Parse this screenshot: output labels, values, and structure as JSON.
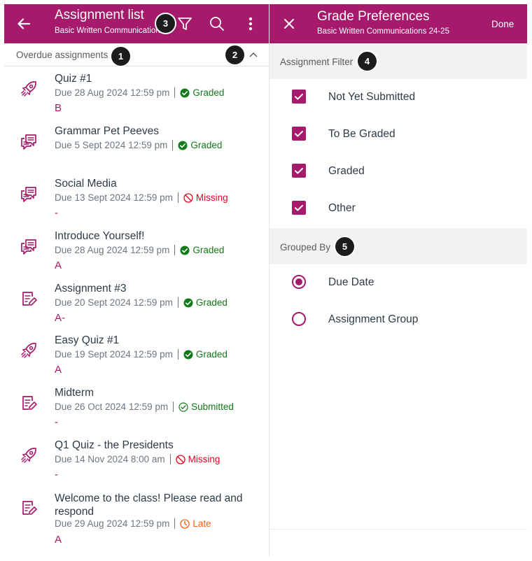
{
  "colors": {
    "brand": "#a51a6b",
    "graded": "#127a1b",
    "missing": "#e0061f",
    "late": "#fc5e13",
    "text": "#2d3b45",
    "secondary": "#6b7780"
  },
  "left": {
    "title": "Assignment list",
    "subtitle": "Basic Written Communications 24-25",
    "icons": {
      "back": "arrow-left-icon",
      "filter": "filter-icon",
      "search": "search-icon",
      "more": "more-vertical-icon"
    },
    "section_header": "Overdue assignments",
    "collapse_icon": "chevron-up-icon",
    "assignments": [
      {
        "type": "quiz",
        "icon": "rocket-icon",
        "name": "Quiz #1",
        "due": "Due 28 Aug 2024 12:59 pm",
        "status": "Graded",
        "status_kind": "graded",
        "grade": "B"
      },
      {
        "type": "discussion",
        "icon": "discussion-icon",
        "name": "Grammar Pet Peeves",
        "due": "Due 5 Sept 2024 12:59 pm",
        "status": "Graded",
        "status_kind": "graded",
        "grade": ""
      },
      {
        "type": "discussion",
        "icon": "discussion-icon",
        "name": "Social Media",
        "due": "Due 13 Sept 2024 12:59 pm",
        "status": "Missing",
        "status_kind": "missing",
        "grade": "-"
      },
      {
        "type": "discussion",
        "icon": "discussion-icon",
        "name": "Introduce Yourself!",
        "due": "Due 28 Aug 2024 12:59 pm",
        "status": "Graded",
        "status_kind": "graded",
        "grade": "A"
      },
      {
        "type": "assignment",
        "icon": "assignment-icon",
        "name": "Assignment #3",
        "due": "Due 20 Sept 2024 12:59 pm",
        "status": "Graded",
        "status_kind": "graded",
        "grade": "A-"
      },
      {
        "type": "quiz",
        "icon": "rocket-icon",
        "name": "Easy Quiz #1",
        "due": "Due 19 Sept 2024 12:59 pm",
        "status": "Graded",
        "status_kind": "graded",
        "grade": "A"
      },
      {
        "type": "assignment",
        "icon": "assignment-icon",
        "name": "Midterm",
        "due": "Due 26 Oct 2024 12:59 pm",
        "status": "Submitted",
        "status_kind": "submitted",
        "grade": "-"
      },
      {
        "type": "quiz",
        "icon": "rocket-icon",
        "name": "Q1 Quiz - the Presidents",
        "due": "Due 14 Nov 2024 8:00 am",
        "status": "Missing",
        "status_kind": "missing",
        "grade": "-"
      },
      {
        "type": "assignment",
        "icon": "assignment-icon",
        "name": "Welcome to the class! Please read and respond",
        "due": "Due 29 Aug 2024 12:59 pm",
        "status": "Late",
        "status_kind": "late",
        "grade": "A"
      }
    ]
  },
  "right": {
    "title": "Grade Preferences",
    "subtitle": "Basic Written Communications 24-25",
    "close_icon": "close-icon",
    "done_label": "Done",
    "filter_header": "Assignment Filter",
    "filters": [
      {
        "label": "Not Yet Submitted",
        "checked": true
      },
      {
        "label": "To Be Graded",
        "checked": true
      },
      {
        "label": "Graded",
        "checked": true
      },
      {
        "label": "Other",
        "checked": true
      }
    ],
    "group_header": "Grouped By",
    "groups": [
      {
        "label": "Due Date",
        "selected": true
      },
      {
        "label": "Assignment Group",
        "selected": false
      }
    ]
  },
  "callouts": [
    "1",
    "2",
    "3",
    "4",
    "5"
  ]
}
